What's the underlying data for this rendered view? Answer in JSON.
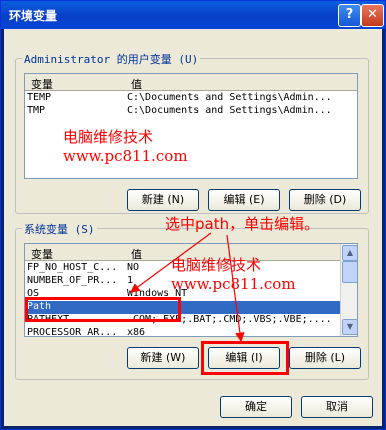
{
  "window": {
    "title": "环境变量"
  },
  "user_vars": {
    "group_label": "Administrator 的用户变量 (U)",
    "columns": [
      "变量",
      "值"
    ],
    "rows": [
      {
        "name": "TEMP",
        "value": "C:\\Documents and Settings\\Admin..."
      },
      {
        "name": "TMP",
        "value": "C:\\Documents and Settings\\Admin..."
      }
    ],
    "buttons": {
      "new": "新建 (N)",
      "edit": "编辑 (E)",
      "delete": "删除 (D)"
    }
  },
  "system_vars": {
    "group_label": "系统变量 (S)",
    "columns": [
      "变量",
      "值"
    ],
    "rows": [
      {
        "name": "FP_NO_HOST_C...",
        "value": "NO"
      },
      {
        "name": "NUMBER_OF_PR...",
        "value": "1"
      },
      {
        "name": "OS",
        "value": "Windows_NT"
      },
      {
        "name": "Path",
        "value": ""
      },
      {
        "name": "PATHEXT",
        "value": ".COM;.EXE;.BAT;.CMD;.VBS;.VBE;...."
      },
      {
        "name": "PROCESSOR_AR...",
        "value": "x86"
      }
    ],
    "buttons": {
      "new": "新建 (W)",
      "edit": "编辑 (I)",
      "delete": "删除 (L)"
    }
  },
  "dialog_buttons": {
    "ok": "确定",
    "cancel": "取消"
  },
  "annotations": {
    "watermark_title": "电脑维修技术",
    "watermark_url": "www.pc811.com",
    "instruction": "选中path，单击编辑。"
  },
  "colors": {
    "annotation": "#ff0000",
    "selection": "#316ac5",
    "titlebar": "#0a3fc8"
  }
}
